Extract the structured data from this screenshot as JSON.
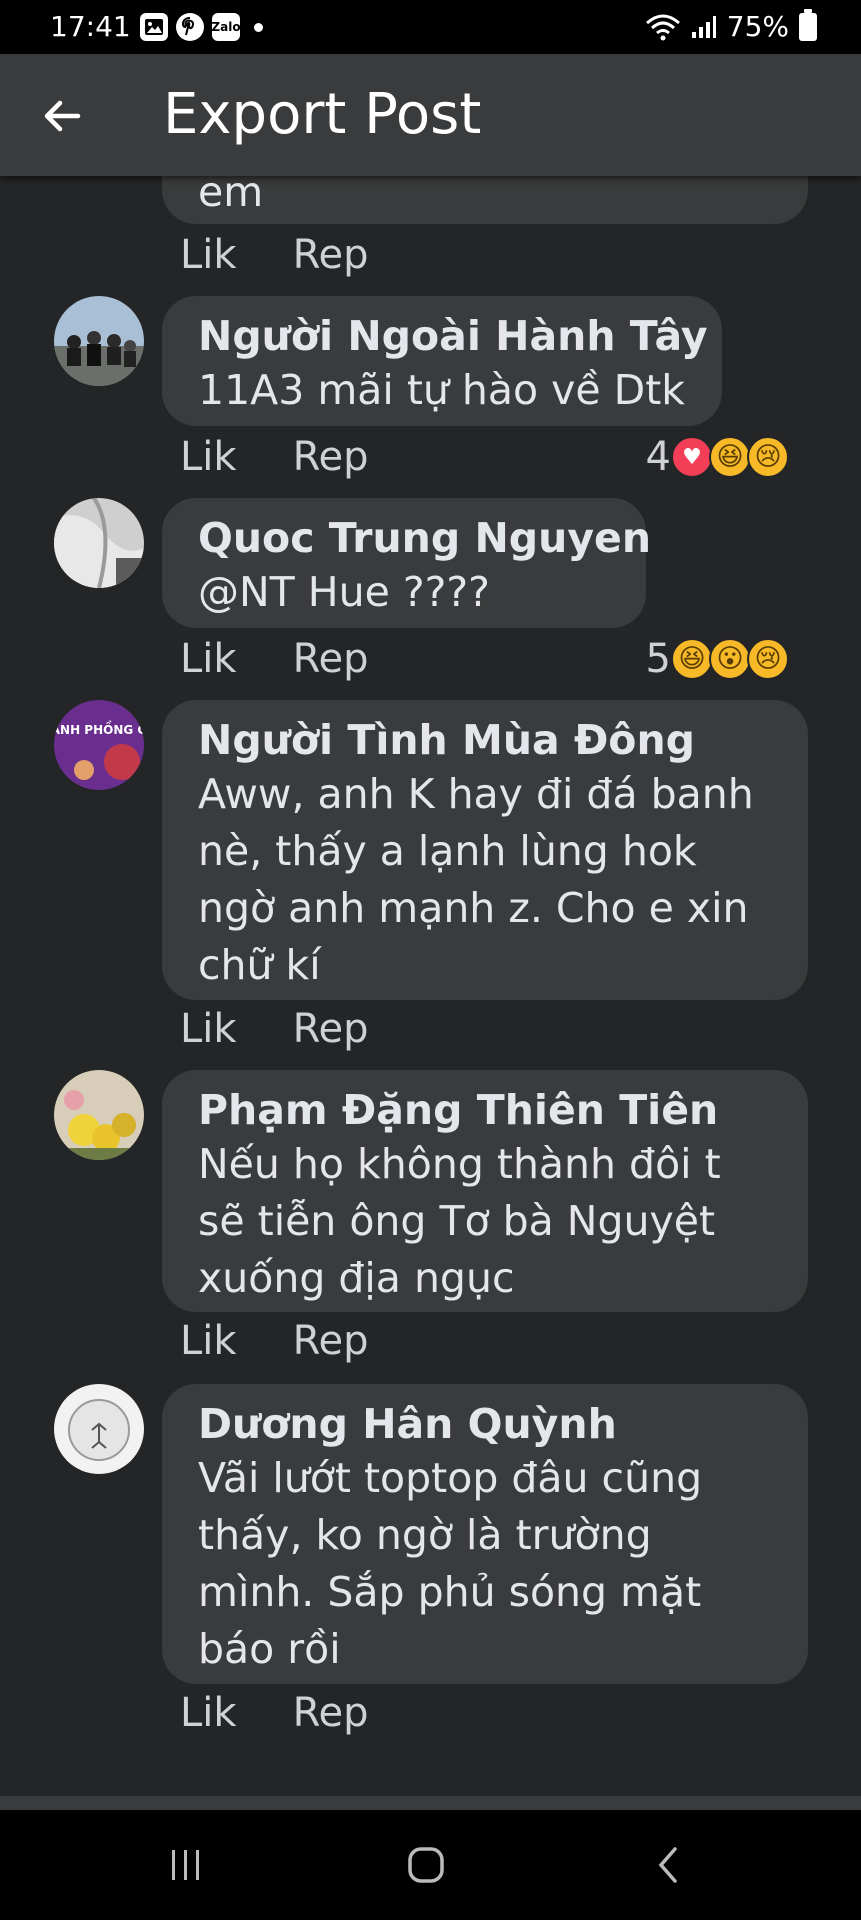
{
  "status": {
    "time": "17:41",
    "notification_icons": [
      "gallery-icon",
      "pinterest-icon",
      "zalo-icon"
    ],
    "zalo_label": "Zalo",
    "battery": "75%"
  },
  "header": {
    "title": "Export Post"
  },
  "comments": [
    {
      "name": "",
      "text": "em",
      "actions": {
        "like": "Lik",
        "reply": "Rep"
      },
      "reactions": null
    },
    {
      "name": "Người Ngoài Hành Tây",
      "text": "11A3 mãi tự hào về Dtk",
      "actions": {
        "like": "Lik",
        "reply": "Rep"
      },
      "reactions": {
        "count": "4",
        "types": [
          "love",
          "haha",
          "sad"
        ]
      }
    },
    {
      "name": "Quoc Trung Nguyen",
      "text": "@NT Hue ????",
      "actions": {
        "like": "Lik",
        "reply": "Rep"
      },
      "reactions": {
        "count": "5",
        "types": [
          "haha",
          "wow",
          "sad"
        ]
      }
    },
    {
      "name": "Người Tình Mùa Đông",
      "text": "Aww, anh K hay đi đá banh nè, thấy a lạnh lùng hok ngờ anh mạnh z. Cho e xin chữ kí",
      "actions": {
        "like": "Lik",
        "reply": "Rep"
      },
      "reactions": null,
      "avatar_text": "BANH PHỒNG CỐ"
    },
    {
      "name": "Phạm Đặng Thiên Tiên",
      "text": "Nếu họ không thành đôi t sẽ tiễn ông Tơ bà Nguyệt xuống địa ngục",
      "actions": {
        "like": "Lik",
        "reply": "Rep"
      },
      "reactions": null
    },
    {
      "name": "Dương Hân Quỳnh",
      "text": "Vãi lướt toptop đâu cũng thấy, ko ngờ là trường mình. Sắp phủ sóng mặt báo rồi",
      "actions": {
        "like": "Lik",
        "reply": "Rep"
      },
      "reactions": null
    }
  ],
  "colors": {
    "background": "#242526",
    "bubble": "#3a3b3c",
    "app_bar": "#3a3b3c",
    "text": "#e4e6eb"
  }
}
